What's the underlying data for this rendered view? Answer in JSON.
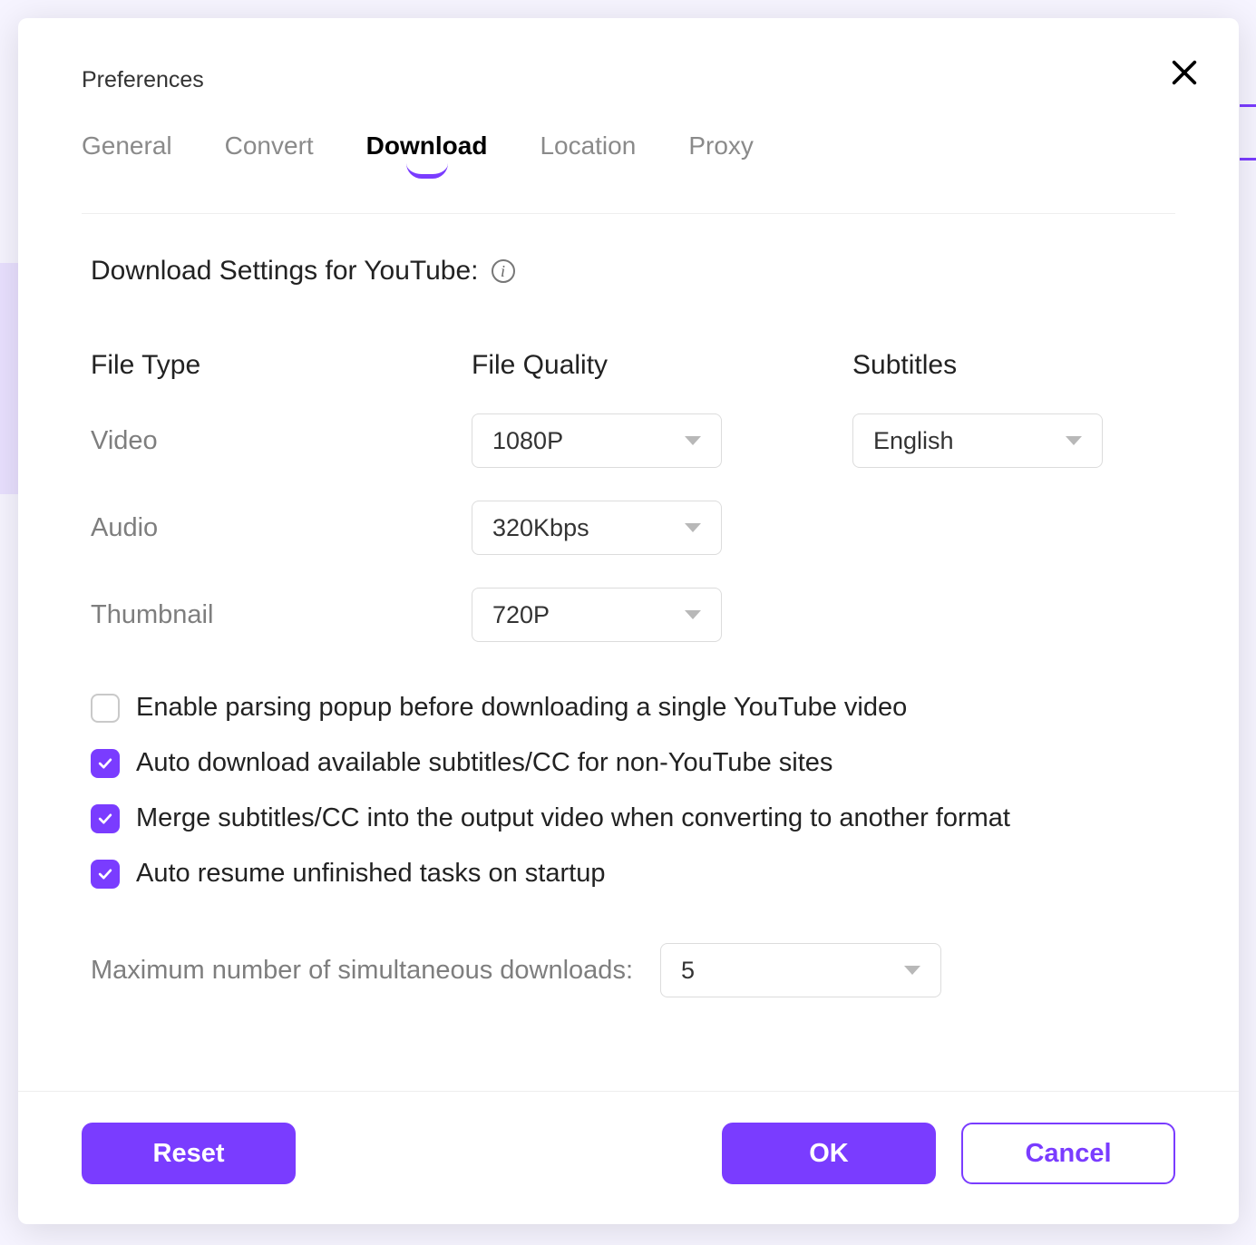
{
  "dialog": {
    "title": "Preferences",
    "tabs": [
      "General",
      "Convert",
      "Download",
      "Location",
      "Proxy"
    ],
    "activeTab": "Download"
  },
  "section": {
    "heading": "Download Settings for YouTube:"
  },
  "columns": {
    "fileType": "File Type",
    "fileQuality": "File Quality",
    "subtitles": "Subtitles"
  },
  "rows": {
    "video": {
      "label": "Video",
      "quality": "1080P",
      "subtitles": "English"
    },
    "audio": {
      "label": "Audio",
      "quality": "320Kbps"
    },
    "thumbnail": {
      "label": "Thumbnail",
      "quality": "720P"
    }
  },
  "checkboxes": {
    "parsingPopup": {
      "checked": false,
      "label": "Enable parsing popup before downloading a single YouTube video"
    },
    "autoSubs": {
      "checked": true,
      "label": "Auto download available subtitles/CC for non-YouTube sites"
    },
    "mergeSubs": {
      "checked": true,
      "label": "Merge subtitles/CC into the output video when converting to another format"
    },
    "autoResume": {
      "checked": true,
      "label": "Auto resume unfinished tasks on startup"
    }
  },
  "maxDownloads": {
    "label": "Maximum number of simultaneous downloads:",
    "value": "5"
  },
  "buttons": {
    "reset": "Reset",
    "ok": "OK",
    "cancel": "Cancel"
  }
}
